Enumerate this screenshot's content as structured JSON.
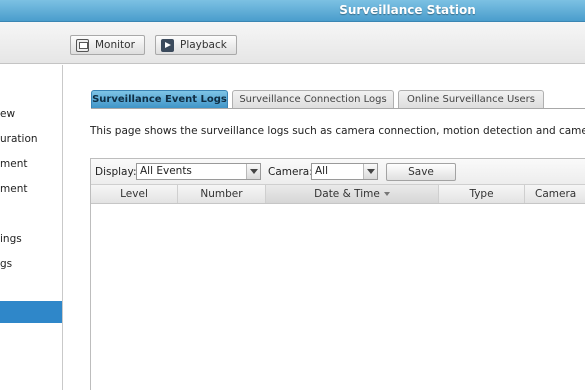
{
  "window": {
    "title": "Surveillance Station"
  },
  "toolbar": {
    "monitor_label": "Monitor",
    "playback_label": "Playback"
  },
  "sidebar": {
    "items": [
      {
        "label": "ew",
        "selected": false
      },
      {
        "label": "uration",
        "selected": false
      },
      {
        "label": "ment",
        "selected": false
      },
      {
        "label": "ment",
        "selected": false
      },
      {
        "label": "ings",
        "selected": false
      },
      {
        "label": "gs",
        "selected": false
      },
      {
        "label": "",
        "selected": true
      }
    ],
    "selected_color": "#2f87c9"
  },
  "tabs": [
    {
      "label": "Surveillance Event Logs",
      "active": true
    },
    {
      "label": "Surveillance Connection Logs",
      "active": false
    },
    {
      "label": "Online Surveillance Users",
      "active": false
    }
  ],
  "description": "This page shows the surveillance logs such as camera connection, motion detection and camera au",
  "filters": {
    "display_label": "Display:",
    "display_value": "All Events",
    "camera_label": "Camera:",
    "camera_value": "All",
    "save_label": "Save"
  },
  "table": {
    "columns": [
      {
        "label": "Level"
      },
      {
        "label": "Number"
      },
      {
        "label": "Date & Time",
        "sorted": "desc"
      },
      {
        "label": "Type"
      },
      {
        "label": "Camera"
      }
    ],
    "rows": []
  },
  "colors": {
    "titlebar": "#4a9dcc",
    "active_tab": "#3c92c6"
  }
}
